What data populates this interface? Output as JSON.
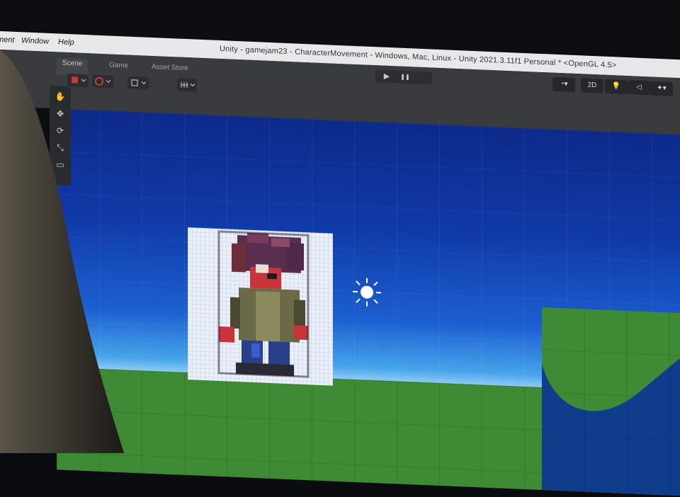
{
  "menubar": {
    "items": [
      "ment",
      "Window",
      "Help"
    ],
    "title": "Unity - gamejam23 - CharacterMovement - Windows, Mac, Linux - Unity 2021.3.11f1 Personal * <OpenGL 4.5>"
  },
  "tabs": [
    "Scene",
    "Game",
    "Asset Store"
  ],
  "playback": {
    "play_icon": "▶",
    "pause_icon": "❚❚"
  },
  "scene_tools": {
    "mode_2d": "2D"
  },
  "colors": {
    "sky_top": "#0d2a8a",
    "horizon": "#b8e4fb",
    "ground": "#3f8a34",
    "water": "#0f3d8c",
    "sprite_bg": "#eaf0fb"
  },
  "icons": [
    "hand-tool-icon",
    "move-tool-icon",
    "rotate-tool-icon",
    "scale-tool-icon",
    "sun-light-icon",
    "gizmo-icon",
    "lighting-icon",
    "audio-icon"
  ]
}
